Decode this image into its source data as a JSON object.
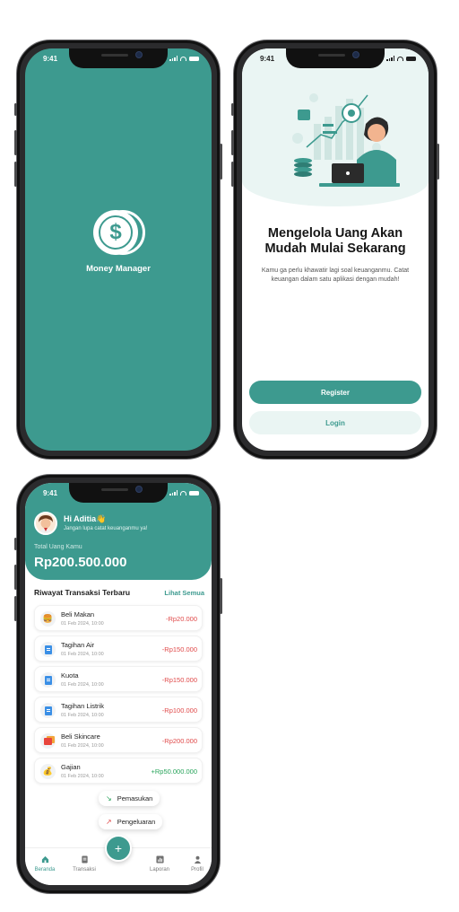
{
  "status_time": "9:41",
  "splash": {
    "app_name": "Money Manager",
    "logo_symbol": "$"
  },
  "onboarding": {
    "title": "Mengelola Uang Akan Mudah Mulai Sekarang",
    "subtitle": "Kamu ga perlu khawatir lagi soal keuanganmu. Catat keuangan dalam satu aplikasi dengan mudah!",
    "register_label": "Register",
    "login_label": "Login"
  },
  "home": {
    "greeting": "Hi Aditia",
    "greeting_emoji": "👋",
    "greeting_sub": "Jangan lupa catat keuanganmu ya!",
    "balance_label": "Total Uang Kamu",
    "balance": "Rp200.500.000",
    "section_title": "Riwayat Transaksi Terbaru",
    "see_all": "Lihat Semua",
    "transactions": [
      {
        "name": "Beli Makan",
        "date": "01 Feb 2024, 10:00",
        "amount": "-Rp20.000",
        "type": "neg",
        "icon": "food-icon"
      },
      {
        "name": "Tagihan Air",
        "date": "01 Feb 2024, 10:00",
        "amount": "-Rp150.000",
        "type": "neg",
        "icon": "bill-icon"
      },
      {
        "name": "Kuota",
        "date": "01 Feb 2024, 10:00",
        "amount": "-Rp150.000",
        "type": "neg",
        "icon": "bill-icon"
      },
      {
        "name": "Tagihan Listrik",
        "date": "01 Feb 2024, 10:00",
        "amount": "-Rp100.000",
        "type": "neg",
        "icon": "bill-icon"
      },
      {
        "name": "Beli Skincare",
        "date": "01 Feb 2024, 10:00",
        "amount": "-Rp200.000",
        "type": "neg",
        "icon": "shopping-icon"
      },
      {
        "name": "Gajian",
        "date": "01 Feb 2024, 10:00",
        "amount": "+Rp50.000.000",
        "type": "pos",
        "icon": "money-bag-icon"
      }
    ],
    "menu_income": "Pemasukan",
    "menu_expense": "Pengeluaran",
    "fab_symbol": "+",
    "tabs": [
      {
        "label": "Beranda",
        "icon": "home-icon",
        "active": true
      },
      {
        "label": "Transaksi",
        "icon": "document-icon",
        "active": false
      },
      {
        "label": "Laporan",
        "icon": "chart-icon",
        "active": false
      },
      {
        "label": "Profil",
        "icon": "user-icon",
        "active": false
      }
    ]
  },
  "colors": {
    "primary": "#3d9a8f",
    "primary_light": "#eaf5f3",
    "negative": "#e04a4a",
    "positive": "#27a35a"
  }
}
